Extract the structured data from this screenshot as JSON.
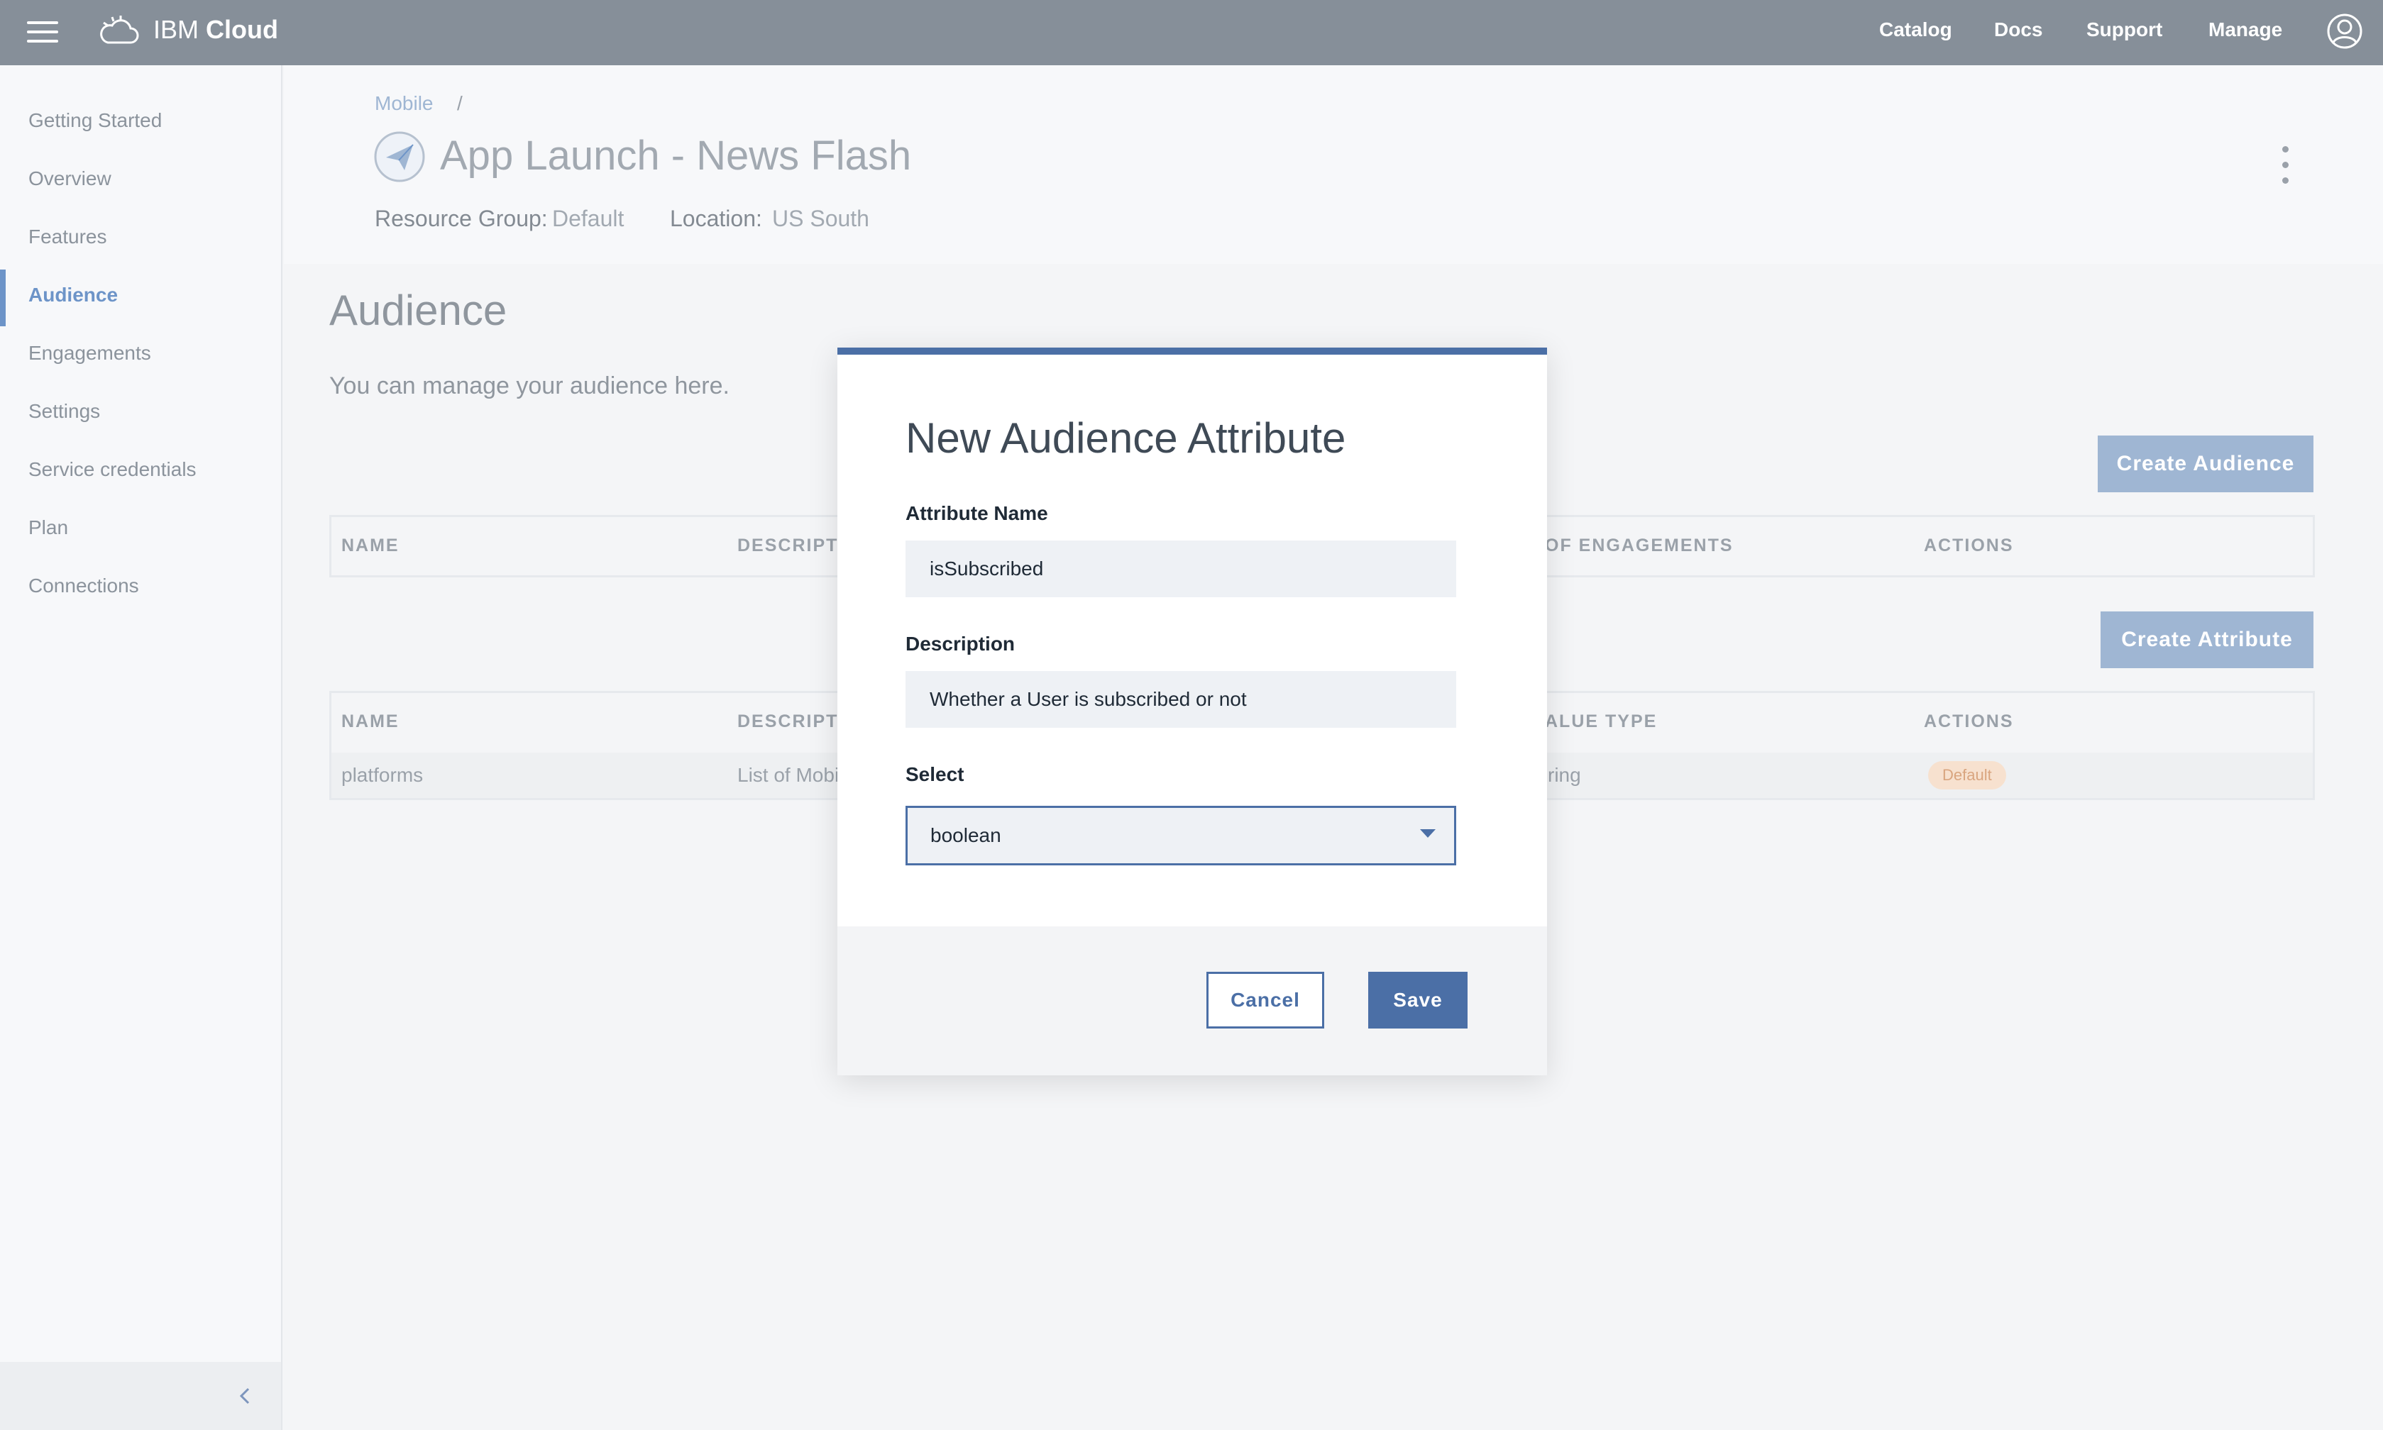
{
  "topbar": {
    "brand_prefix": "IBM",
    "brand_name": "Cloud",
    "nav": [
      "Catalog",
      "Docs",
      "Support",
      "Manage"
    ]
  },
  "sidebar": {
    "items": [
      {
        "label": "Getting Started"
      },
      {
        "label": "Overview"
      },
      {
        "label": "Features"
      },
      {
        "label": "Audience"
      },
      {
        "label": "Engagements"
      },
      {
        "label": "Settings"
      },
      {
        "label": "Service credentials"
      },
      {
        "label": "Plan"
      },
      {
        "label": "Connections"
      }
    ],
    "active": "Audience"
  },
  "header": {
    "breadcrumb": "Mobile",
    "breadcrumb_sep": "/",
    "title": "App Launch - News Flash",
    "resource_group_label": "Resource Group:",
    "resource_group_value": "Default",
    "location_label": "Location:",
    "location_value": "US South"
  },
  "main": {
    "title": "Audience",
    "subtitle": "You can manage your audience here.",
    "create_audience": "Create Audience",
    "create_attribute": "Create Attribute",
    "audience_table": {
      "headers": [
        "NAME",
        "DESCRIPTI",
        "OF ENGAGEMENTS",
        "ACTIONS"
      ]
    },
    "attribute_table": {
      "headers": [
        "NAME",
        "DESCRIPTI",
        "ALUE TYPE",
        "ACTIONS"
      ],
      "rows": [
        {
          "name": "platforms",
          "description": "List of Mobi",
          "value_type": "ring",
          "action": "Default"
        }
      ]
    }
  },
  "modal": {
    "title": "New Audience Attribute",
    "attribute_name_label": "Attribute Name",
    "attribute_name_value": "isSubscribed",
    "description_label": "Description",
    "description_value": "Whether a User is subscribed or not",
    "select_label": "Select",
    "select_value": "boolean",
    "cancel": "Cancel",
    "save": "Save"
  },
  "colors": {
    "topbar": "#868f99",
    "accent": "#4b6fa6",
    "accent_light": "#9fb6d3",
    "badge_bg": "#f7e1cf"
  }
}
